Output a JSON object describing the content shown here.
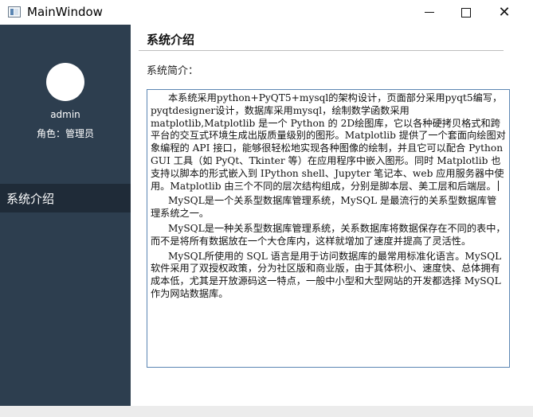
{
  "window": {
    "title": "MainWindow",
    "minimize_glyph": "",
    "maximize_glyph": "",
    "close_glyph": "✕"
  },
  "sidebar": {
    "username": "admin",
    "role": "角色：管理员",
    "items": [
      {
        "label": "系统介绍",
        "selected": true
      }
    ]
  },
  "main": {
    "page_title": "系统介绍",
    "section_label": "系统简介：",
    "paragraphs": [
      "本系统采用python+PyQT5+mysql的架构设计，页面部分采用pyqt5编写，pyqtdesigner设计，数据库采用mysql，绘制数学函数采用matplotlib,Matplotlib 是一个 Python 的 2D绘图库，它以各种硬拷贝格式和跨平台的交互式环境生成出版质量级别的图形。Matplotlib 提供了一个套面向绘图对象编程的 API 接口，能够很轻松地实现各种图像的绘制，并且它可以配合 Python GUI 工具（如 PyQt、Tkinter 等）在应用程序中嵌入图形。同时 Matplotlib 也支持以脚本的形式嵌入到 IPython shell、Jupyter 笔记本、web 应用服务器中使用。Matplotlib 由三个不同的层次结构组成，分别是脚本层、美工层和后端层。",
      "MySQL是一个关系型数据库管理系统，MySQL 是最流行的关系型数据库管理系统之一。",
      "MySQL是一种关系型数据库管理系统，关系数据库将数据保存在不同的表中，而不是将所有数据放在一个大仓库内，这样就增加了速度并提高了灵活性。",
      "MySQL所使用的 SQL 语言是用于访问数据库的最常用标准化语言。MySQL 软件采用了双授权政策，分为社区版和商业版，由于其体积小、速度快、总体拥有成本低，尤其是开放源码这一特点，一般中小型和大型网站的开发都选择 MySQL 作为网站数据库。"
    ]
  },
  "colors": {
    "sidebar_bg": "#2d3e4f",
    "nav_selected_bg": "#1f2b38",
    "textbox_border": "#5b86b3"
  }
}
